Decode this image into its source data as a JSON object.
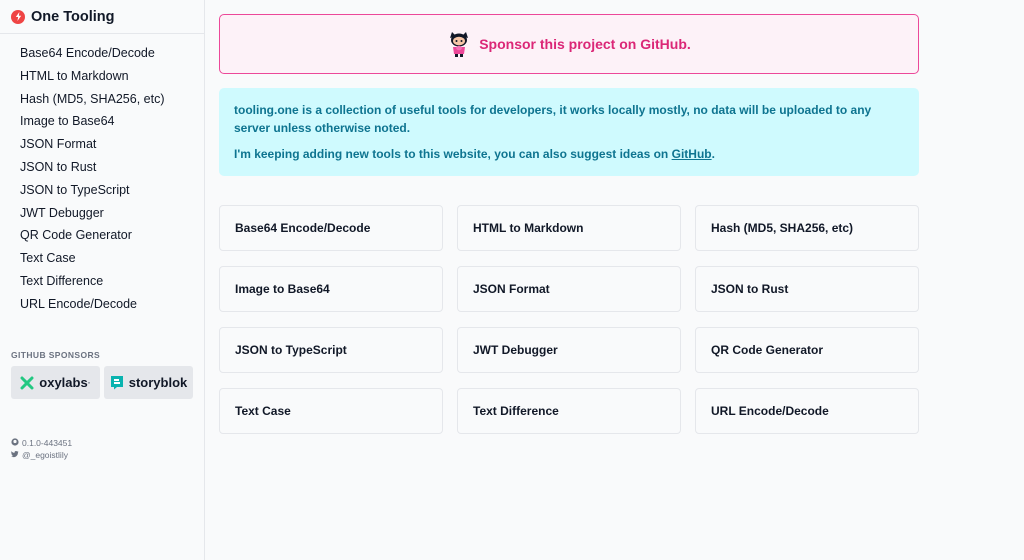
{
  "app": {
    "title": "One Tooling",
    "logo_icon": "lightning-bolt-icon",
    "accent": "#ef4444"
  },
  "sidebar": {
    "items": [
      {
        "label": "Base64 Encode/Decode"
      },
      {
        "label": "HTML to Markdown"
      },
      {
        "label": "Hash (MD5, SHA256, etc)"
      },
      {
        "label": "Image to Base64"
      },
      {
        "label": "JSON Format"
      },
      {
        "label": "JSON to Rust"
      },
      {
        "label": "JSON to TypeScript"
      },
      {
        "label": "JWT Debugger"
      },
      {
        "label": "QR Code Generator"
      },
      {
        "label": "Text Case"
      },
      {
        "label": "Text Difference"
      },
      {
        "label": "URL Encode/Decode"
      }
    ],
    "sponsors_heading": "GITHUB SPONSORS",
    "sponsors": [
      {
        "name": "oxylabs",
        "suffix": "·",
        "icon": "oxylabs-x-icon",
        "color": "#23c882"
      },
      {
        "name": "storyblok",
        "icon": "storyblok-icon",
        "color": "#09b3af"
      }
    ],
    "version": "0.1.0-443451",
    "twitter": "@_egoistlily"
  },
  "main": {
    "sponsor_banner": {
      "text": "Sponsor this project on GitHub.",
      "icon": "octocat-icon",
      "color": "#db2777"
    },
    "info": {
      "line1": "tooling.one is a collection of useful tools for developers, it works locally mostly, no data will be uploaded to any server unless otherwise noted.",
      "line2_prefix": "I'm keeping adding new tools to this website, you can also suggest ideas on ",
      "line2_link": "GitHub",
      "line2_suffix": "."
    },
    "cards": [
      {
        "label": "Base64 Encode/Decode"
      },
      {
        "label": "HTML to Markdown"
      },
      {
        "label": "Hash (MD5, SHA256, etc)"
      },
      {
        "label": "Image to Base64"
      },
      {
        "label": "JSON Format"
      },
      {
        "label": "JSON to Rust"
      },
      {
        "label": "JSON to TypeScript"
      },
      {
        "label": "JWT Debugger"
      },
      {
        "label": "QR Code Generator"
      },
      {
        "label": "Text Case"
      },
      {
        "label": "Text Difference"
      },
      {
        "label": "URL Encode/Decode"
      }
    ]
  }
}
